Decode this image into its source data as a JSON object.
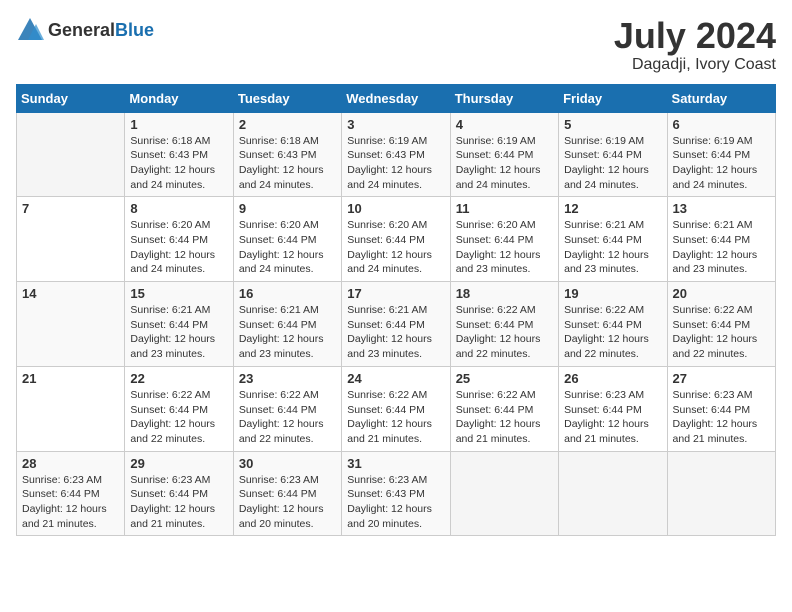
{
  "header": {
    "logo_general": "General",
    "logo_blue": "Blue",
    "month_year": "July 2024",
    "location": "Dagadji, Ivory Coast"
  },
  "calendar": {
    "days_of_week": [
      "Sunday",
      "Monday",
      "Tuesday",
      "Wednesday",
      "Thursday",
      "Friday",
      "Saturday"
    ],
    "weeks": [
      [
        {
          "day": "",
          "info": ""
        },
        {
          "day": "1",
          "info": "Sunrise: 6:18 AM\nSunset: 6:43 PM\nDaylight: 12 hours\nand 24 minutes."
        },
        {
          "day": "2",
          "info": "Sunrise: 6:18 AM\nSunset: 6:43 PM\nDaylight: 12 hours\nand 24 minutes."
        },
        {
          "day": "3",
          "info": "Sunrise: 6:19 AM\nSunset: 6:43 PM\nDaylight: 12 hours\nand 24 minutes."
        },
        {
          "day": "4",
          "info": "Sunrise: 6:19 AM\nSunset: 6:44 PM\nDaylight: 12 hours\nand 24 minutes."
        },
        {
          "day": "5",
          "info": "Sunrise: 6:19 AM\nSunset: 6:44 PM\nDaylight: 12 hours\nand 24 minutes."
        },
        {
          "day": "6",
          "info": "Sunrise: 6:19 AM\nSunset: 6:44 PM\nDaylight: 12 hours\nand 24 minutes."
        }
      ],
      [
        {
          "day": "7",
          "info": ""
        },
        {
          "day": "8",
          "info": "Sunrise: 6:20 AM\nSunset: 6:44 PM\nDaylight: 12 hours\nand 24 minutes."
        },
        {
          "day": "9",
          "info": "Sunrise: 6:20 AM\nSunset: 6:44 PM\nDaylight: 12 hours\nand 24 minutes."
        },
        {
          "day": "10",
          "info": "Sunrise: 6:20 AM\nSunset: 6:44 PM\nDaylight: 12 hours\nand 24 minutes."
        },
        {
          "day": "11",
          "info": "Sunrise: 6:20 AM\nSunset: 6:44 PM\nDaylight: 12 hours\nand 23 minutes."
        },
        {
          "day": "12",
          "info": "Sunrise: 6:21 AM\nSunset: 6:44 PM\nDaylight: 12 hours\nand 23 minutes."
        },
        {
          "day": "13",
          "info": "Sunrise: 6:21 AM\nSunset: 6:44 PM\nDaylight: 12 hours\nand 23 minutes."
        }
      ],
      [
        {
          "day": "14",
          "info": ""
        },
        {
          "day": "15",
          "info": "Sunrise: 6:21 AM\nSunset: 6:44 PM\nDaylight: 12 hours\nand 23 minutes."
        },
        {
          "day": "16",
          "info": "Sunrise: 6:21 AM\nSunset: 6:44 PM\nDaylight: 12 hours\nand 23 minutes."
        },
        {
          "day": "17",
          "info": "Sunrise: 6:21 AM\nSunset: 6:44 PM\nDaylight: 12 hours\nand 23 minutes."
        },
        {
          "day": "18",
          "info": "Sunrise: 6:22 AM\nSunset: 6:44 PM\nDaylight: 12 hours\nand 22 minutes."
        },
        {
          "day": "19",
          "info": "Sunrise: 6:22 AM\nSunset: 6:44 PM\nDaylight: 12 hours\nand 22 minutes."
        },
        {
          "day": "20",
          "info": "Sunrise: 6:22 AM\nSunset: 6:44 PM\nDaylight: 12 hours\nand 22 minutes."
        }
      ],
      [
        {
          "day": "21",
          "info": ""
        },
        {
          "day": "22",
          "info": "Sunrise: 6:22 AM\nSunset: 6:44 PM\nDaylight: 12 hours\nand 22 minutes."
        },
        {
          "day": "23",
          "info": "Sunrise: 6:22 AM\nSunset: 6:44 PM\nDaylight: 12 hours\nand 22 minutes."
        },
        {
          "day": "24",
          "info": "Sunrise: 6:22 AM\nSunset: 6:44 PM\nDaylight: 12 hours\nand 21 minutes."
        },
        {
          "day": "25",
          "info": "Sunrise: 6:22 AM\nSunset: 6:44 PM\nDaylight: 12 hours\nand 21 minutes."
        },
        {
          "day": "26",
          "info": "Sunrise: 6:23 AM\nSunset: 6:44 PM\nDaylight: 12 hours\nand 21 minutes."
        },
        {
          "day": "27",
          "info": "Sunrise: 6:23 AM\nSunset: 6:44 PM\nDaylight: 12 hours\nand 21 minutes."
        }
      ],
      [
        {
          "day": "28",
          "info": "Sunrise: 6:23 AM\nSunset: 6:44 PM\nDaylight: 12 hours\nand 21 minutes."
        },
        {
          "day": "29",
          "info": "Sunrise: 6:23 AM\nSunset: 6:44 PM\nDaylight: 12 hours\nand 21 minutes."
        },
        {
          "day": "30",
          "info": "Sunrise: 6:23 AM\nSunset: 6:44 PM\nDaylight: 12 hours\nand 20 minutes."
        },
        {
          "day": "31",
          "info": "Sunrise: 6:23 AM\nSunset: 6:43 PM\nDaylight: 12 hours\nand 20 minutes."
        },
        {
          "day": "",
          "info": ""
        },
        {
          "day": "",
          "info": ""
        },
        {
          "day": "",
          "info": ""
        }
      ]
    ]
  }
}
